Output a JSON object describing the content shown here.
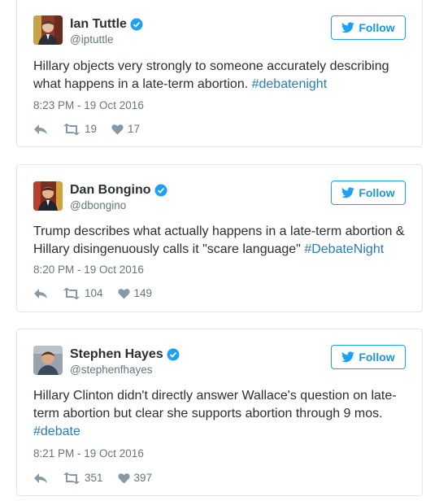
{
  "follow_label": "Follow",
  "colors": {
    "accent": "#1da1f2",
    "link": "#2b7bb9",
    "muted": "#66757f",
    "border": "#e1e8ed"
  },
  "tweets": [
    {
      "name": "Ian Tuttle",
      "handle": "@iptuttle",
      "text_plain": "Hillary objects very strongly to someone accurately describing what happens in a late-term abortion. ",
      "hashtag": "#debatenight",
      "time": "8:23 PM - 19 Oct 2016",
      "retweets": "19",
      "likes": "17"
    },
    {
      "name": "Dan Bongino",
      "handle": "@dbongino",
      "text_plain": "Trump describes what actually happens in a late-term abortion & Hillary disingenuously calls it \"scare language\" ",
      "hashtag": "#DebateNight",
      "time": "8:20 PM - 19 Oct 2016",
      "retweets": "104",
      "likes": "149"
    },
    {
      "name": "Stephen Hayes",
      "handle": "@stephenfhayes",
      "text_plain": "Hillary Clinton didn't directly answer Wallace's question on late-term abortion but clear she supports abortion through 9 mos. ",
      "hashtag": "#debate",
      "time": "8:21 PM - 19 Oct 2016",
      "retweets": "351",
      "likes": "397"
    }
  ]
}
